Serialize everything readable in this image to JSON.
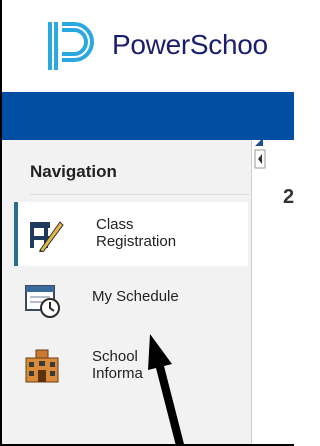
{
  "header": {
    "brand": "PowerSchoo"
  },
  "sidebar": {
    "title": "Navigation",
    "items": [
      {
        "label_line1": "Class",
        "label_line2": "Registration",
        "icon": "class-registration-icon",
        "active": true
      },
      {
        "label": "My Schedule",
        "icon": "calendar-clock-icon"
      },
      {
        "label_line1": "School",
        "label_line2": "Informa",
        "icon": "school-building-icon"
      }
    ]
  },
  "main": {
    "heading_fragment": "2"
  },
  "colors": {
    "brand_navy": "#1b1f6b",
    "topbar_blue": "#004fa3",
    "active_accent": "#2d6e8f"
  }
}
